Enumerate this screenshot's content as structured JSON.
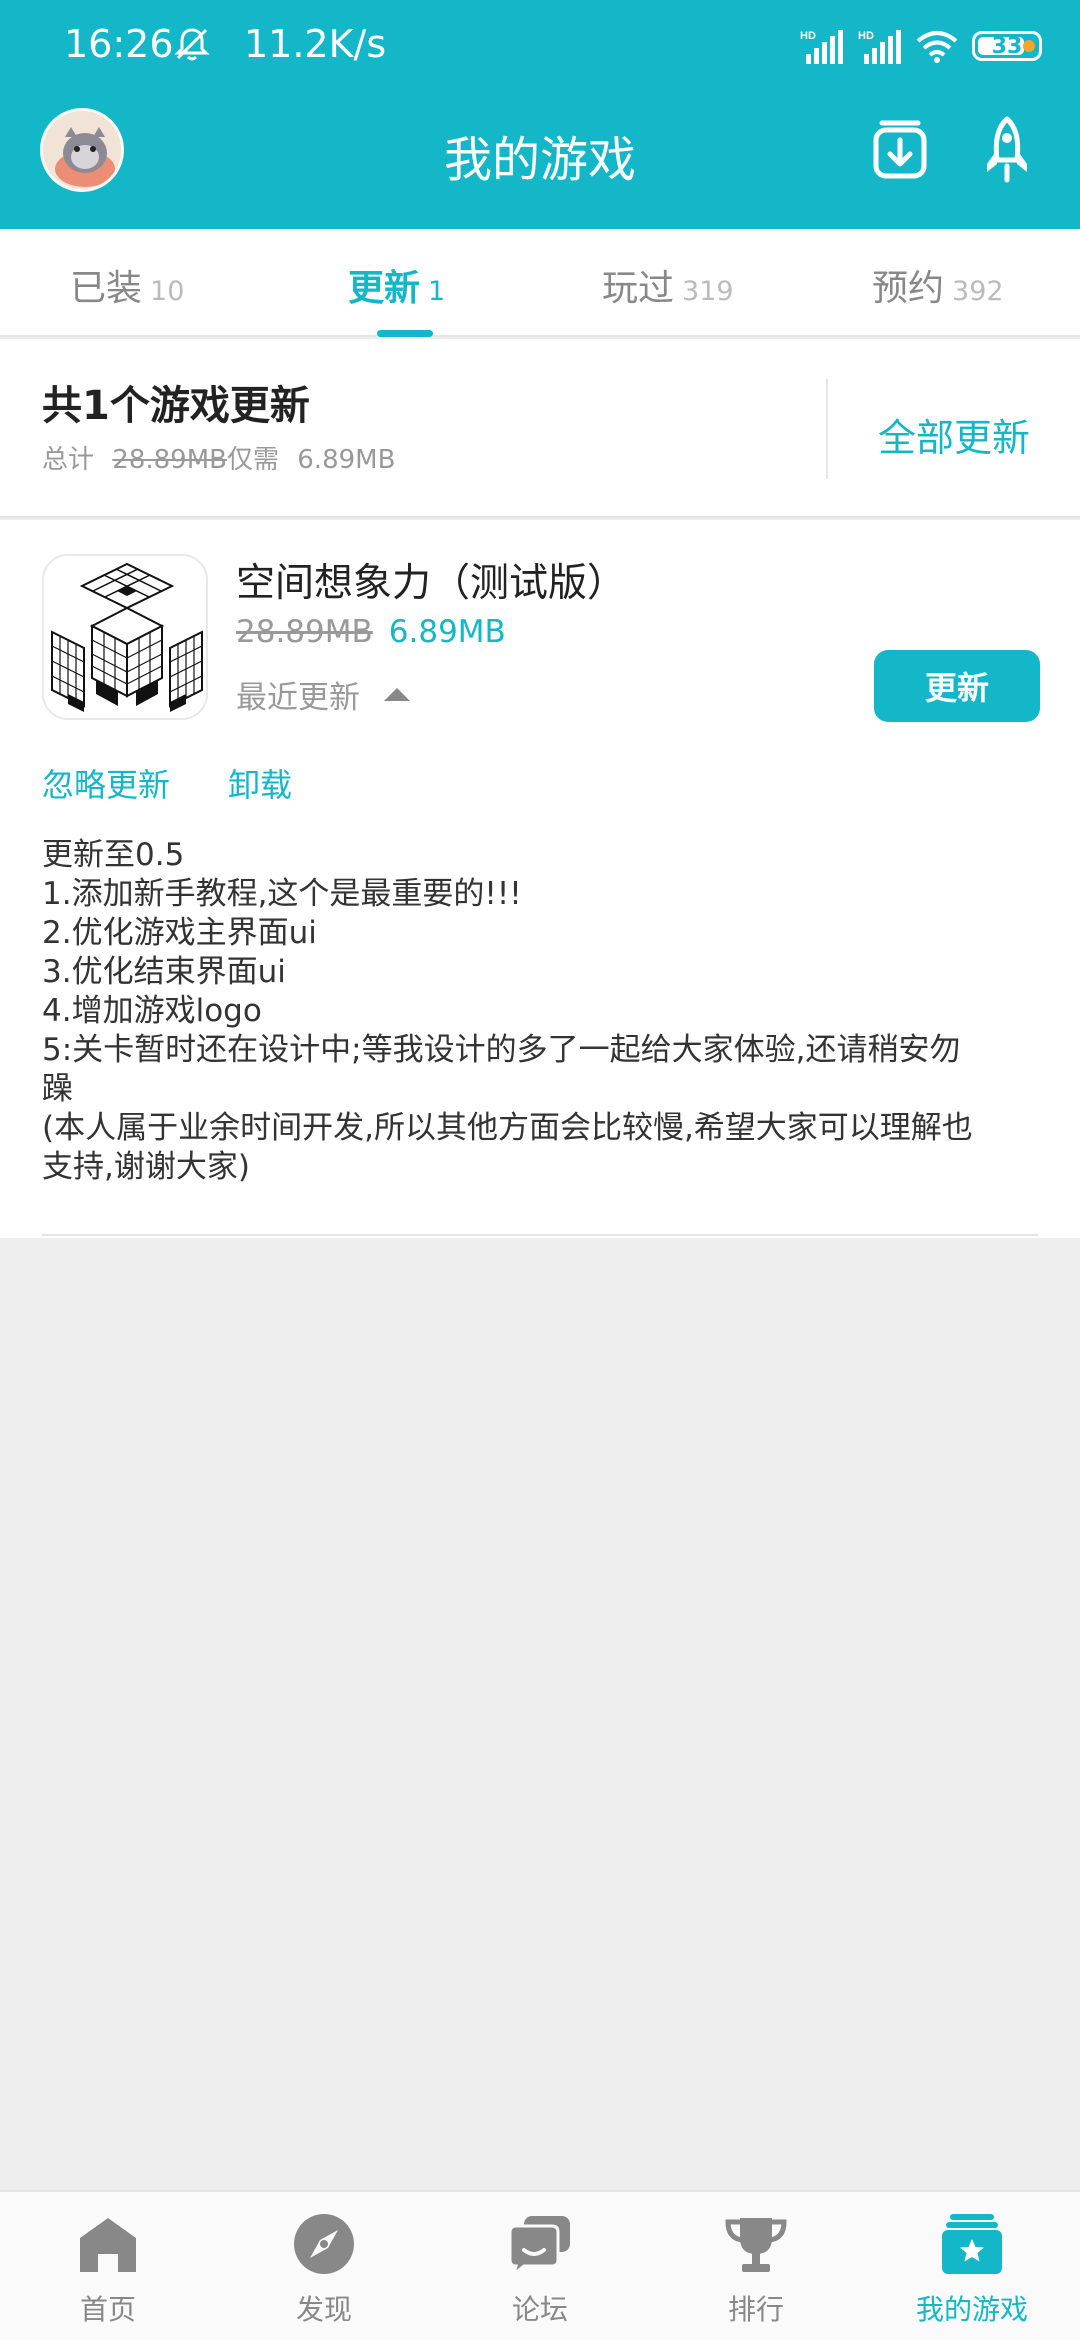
{
  "colors": {
    "accent": "#14b7c8",
    "nav_inactive": "#888888"
  },
  "status_bar": {
    "time": "16:26",
    "net_speed": "11.2K/s",
    "battery": "33"
  },
  "header": {
    "title": "我的游戏"
  },
  "tabs": [
    {
      "label": "已装",
      "count": "10",
      "active": false
    },
    {
      "label": "更新",
      "count": "1",
      "active": true
    },
    {
      "label": "玩过",
      "count": "319",
      "active": false
    },
    {
      "label": "预约",
      "count": "392",
      "active": false
    }
  ],
  "summary": {
    "title": "共1个游戏更新",
    "total_label": "总计",
    "total_size": "28.89MB",
    "need_label": "仅需",
    "need_size": "6.89MB",
    "update_all": "全部更新"
  },
  "game": {
    "name": "空间想象力（测试版）",
    "old_size": "28.89MB",
    "new_size": "6.89MB",
    "recent_label": "最近更新",
    "update_button": "更新",
    "ignore_link": "忽略更新",
    "uninstall_link": "卸载",
    "changelog": [
      "更新至0.5",
      "1.添加新手教程,这个是最重要的!!!",
      "2.优化游戏主界面ui",
      "3.优化结束界面ui",
      "4.增加游戏logo",
      "5:关卡暂时还在设计中;等我设计的多了一起给大家体验,还请稍安勿",
      "躁",
      "(本人属于业余时间开发,所以其他方面会比较慢,希望大家可以理解也",
      "支持,谢谢大家)"
    ]
  },
  "bottom_nav": [
    {
      "label": "首页",
      "icon": "home-icon",
      "active": false
    },
    {
      "label": "发现",
      "icon": "compass-icon",
      "active": false
    },
    {
      "label": "论坛",
      "icon": "forum-icon",
      "active": false
    },
    {
      "label": "排行",
      "icon": "trophy-icon",
      "active": false
    },
    {
      "label": "我的游戏",
      "icon": "my-games-icon",
      "active": true
    }
  ]
}
